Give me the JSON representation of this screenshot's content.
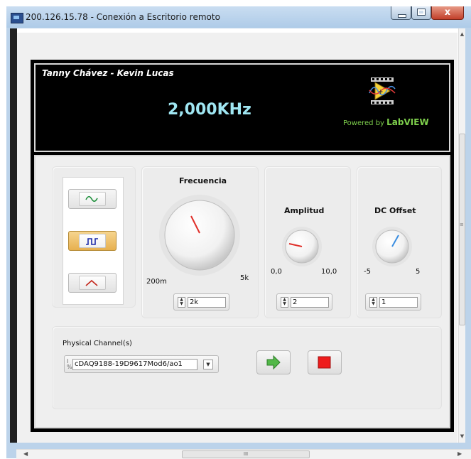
{
  "window": {
    "title": "200.126.15.78 - Conexión a Escritorio remoto",
    "close_glyph": "x"
  },
  "banner": {
    "authors": "Tanny Chávez - Kevin Lucas",
    "frequency_readout": "2,000KHz",
    "powered_by": "Powered by",
    "brand": "LabVIEW"
  },
  "waveform": {
    "options": [
      "sine",
      "square",
      "triangle"
    ],
    "selected": "square"
  },
  "frecuencia": {
    "label": "Frecuencia",
    "min_label": "200m",
    "max_label": "5k",
    "value": "2k"
  },
  "amplitud": {
    "label": "Amplitud",
    "min_label": "0,0",
    "max_label": "10,0",
    "value": "2"
  },
  "dc_offset": {
    "label": "DC Offset",
    "min_label": "-5",
    "max_label": "5",
    "value": "1"
  },
  "channel": {
    "label": "Physical Channel(s)",
    "value": "cDAQ9188-19D9617Mod6/ao1"
  },
  "controls": {
    "run_icon": "green-arrow-icon",
    "stop_icon": "red-square-icon"
  },
  "colors": {
    "readout": "#9fe6f2",
    "brand": "#7ed04c",
    "needle_red": "#e0302a",
    "needle_blue": "#3a8de0",
    "selected_button": "#e7b04f"
  },
  "scrollbar": {
    "grip": "III",
    "side_grip": "≡"
  }
}
